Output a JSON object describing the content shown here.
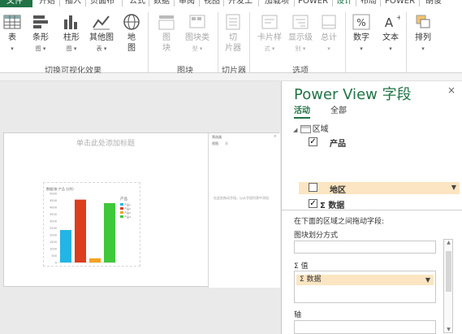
{
  "tabs": [
    "文件",
    "开始",
    "插入",
    "页面布",
    "公式",
    "数据",
    "审阅",
    "视图",
    "开发工",
    "加载项",
    "POWER",
    "设计",
    "布局",
    "POWER",
    "胡俊"
  ],
  "ribbon": {
    "buttons": [
      {
        "label": "表",
        "sub": "▾"
      },
      {
        "label": "条形",
        "sub": "图 ▾"
      },
      {
        "label": "柱形",
        "sub": "图 ▾"
      },
      {
        "label": "其他图",
        "sub": "表 ▾"
      },
      {
        "label": "地",
        "sub": "图"
      },
      {
        "label": "图",
        "sub": "块"
      },
      {
        "label": "图块类",
        "sub": "型 ▾"
      },
      {
        "label": "切",
        "sub": "片器"
      },
      {
        "label": "卡片样",
        "sub": "式 ▾"
      },
      {
        "label": "显示级",
        "sub": "别 ▾"
      },
      {
        "label": "总计",
        "sub": "▾"
      },
      {
        "label": "数字",
        "sub": "▾"
      },
      {
        "label": "文本",
        "sub": "▾"
      },
      {
        "label": "排列",
        "sub": "▾"
      }
    ],
    "groups": [
      "切换可视化效果",
      "图块",
      "切片器",
      "选项"
    ]
  },
  "canvas": {
    "title_hint": "单击此处添加标题",
    "chart_title": "数据(按 产品 分列)",
    "filters_title": "筛选器",
    "filters_close": "×",
    "filters_tabs": [
      "视图",
      "表"
    ],
    "filters_hint": "在此处拖动字段，以从字段列表中添加"
  },
  "chart_data": {
    "type": "bar",
    "categories": [
      "产品1",
      "产品2",
      "产品3",
      "产品4"
    ],
    "values": [
      2350,
      4550,
      300,
      4300
    ],
    "colors": [
      "#22b5e6",
      "#dc3d1d",
      "#f5a21f",
      "#3fc83a"
    ],
    "ylim": [
      0,
      5000
    ],
    "yticks": [
      0,
      500,
      1000,
      1500,
      2000,
      2500,
      3000,
      3500,
      4000,
      4500,
      5000
    ],
    "legend_title": "产品",
    "legend": [
      "产品1",
      "产品2",
      "产品3",
      "产品4"
    ]
  },
  "panel": {
    "title": "Power View 字段",
    "close": "×",
    "tab_active": "活动",
    "tab_all": "全部",
    "table_name": "区域",
    "fields": [
      {
        "label": "产品",
        "checked": true
      },
      {
        "label": "地区",
        "checked": false
      },
      {
        "label": "Σ 数据",
        "checked": true
      }
    ],
    "drag_hint": "在下面的区域之间拖动字段:",
    "zone_tile_by": "图块划分方式",
    "zone_values": "Σ 值",
    "values_item": "Σ 数据",
    "zone_axis": "轴"
  }
}
